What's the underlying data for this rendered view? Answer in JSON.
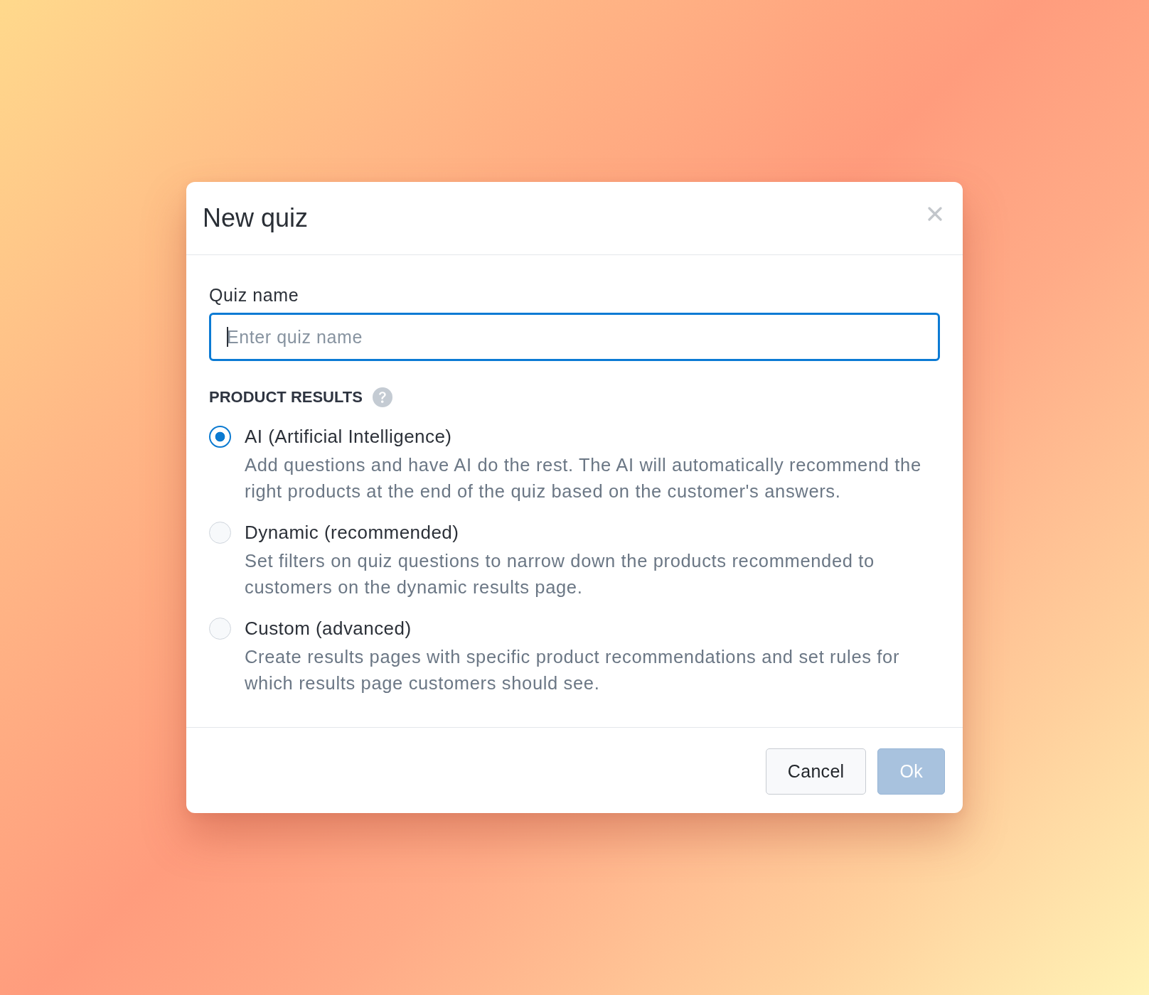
{
  "dialog": {
    "title": "New quiz"
  },
  "quiz_name": {
    "label": "Quiz name",
    "placeholder": "Enter quiz name",
    "focused": true
  },
  "product_results": {
    "heading": "PRODUCT RESULTS",
    "options": [
      {
        "title": "AI (Artificial Intelligence)",
        "description": "Add questions and have AI do the rest. The AI will automatically recommend the right products at the end of the quiz based on the customer's answers.",
        "selected": true
      },
      {
        "title": "Dynamic (recommended)",
        "description": "Set filters on quiz questions to narrow down the products recommended to customers on the dynamic results page.",
        "selected": false
      },
      {
        "title": "Custom (advanced)",
        "description": "Create results pages with specific product recommendations and set rules for which results page customers should see.",
        "selected": false
      }
    ]
  },
  "buttons": [
    {
      "label": "Cancel",
      "kind": "secondary",
      "disabled": false
    },
    {
      "label": "Ok",
      "kind": "primary",
      "disabled": true
    }
  ]
}
